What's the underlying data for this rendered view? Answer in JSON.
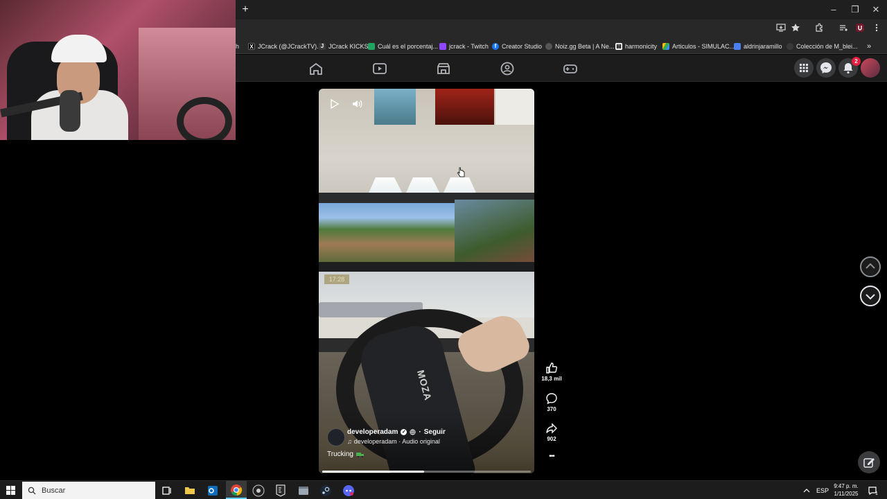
{
  "browser": {
    "new_tab": "+",
    "window_controls": [
      "–",
      "❐",
      "✕"
    ],
    "bookmarks": [
      {
        "label": "h",
        "icon": "tab-fragment-icon",
        "color": "#3a3a3a"
      },
      {
        "label": "JCrack (@JCrackTV)...",
        "icon": "x-twitter-icon",
        "color": "#000000"
      },
      {
        "label": "JCrack KICKS",
        "icon": "jcrack-logo-icon",
        "color": "#3a3a3a"
      },
      {
        "label": "Cuál es el porcentaj...",
        "icon": "google-sheets-icon",
        "color": "#1fa463"
      },
      {
        "label": "jcrack - Twitch",
        "icon": "twitch-icon",
        "color": "#9146ff"
      },
      {
        "label": "Creator Studio",
        "icon": "facebook-icon",
        "color": "#1877f2"
      },
      {
        "label": "Noiz.gg Beta | A Ne...",
        "icon": "noiz-icon",
        "color": "#555555"
      },
      {
        "label": "harmonicity",
        "icon": "harmonicity-icon",
        "color": "#ffffff"
      },
      {
        "label": "Articulos - SIMULAC...",
        "icon": "google-drive-icon",
        "color": "#fbbc04"
      },
      {
        "label": "aldrinjaramillo",
        "icon": "doc-icon",
        "color": "#4a7ff0"
      },
      {
        "label": "Colección de M_blei...",
        "icon": "collection-icon",
        "color": "#3a3a3a"
      }
    ],
    "overflow": "»"
  },
  "facebook": {
    "notification_count": "2",
    "accent": "#0866ff"
  },
  "reel": {
    "owner": "developeradam",
    "follow_label": "Seguir",
    "audio": "developeradam · Audio original",
    "caption": "Trucking",
    "clock_text": "17:28",
    "brand_text": "MOZA",
    "progress": 0.49,
    "likes": "18,3 mil",
    "comments": "370",
    "shares": "902",
    "more": "•••"
  },
  "taskbar": {
    "search_placeholder": "Buscar",
    "language": "ESP",
    "time": "9:47 p. m.",
    "date": "1/11/2025",
    "notifications": "1"
  }
}
